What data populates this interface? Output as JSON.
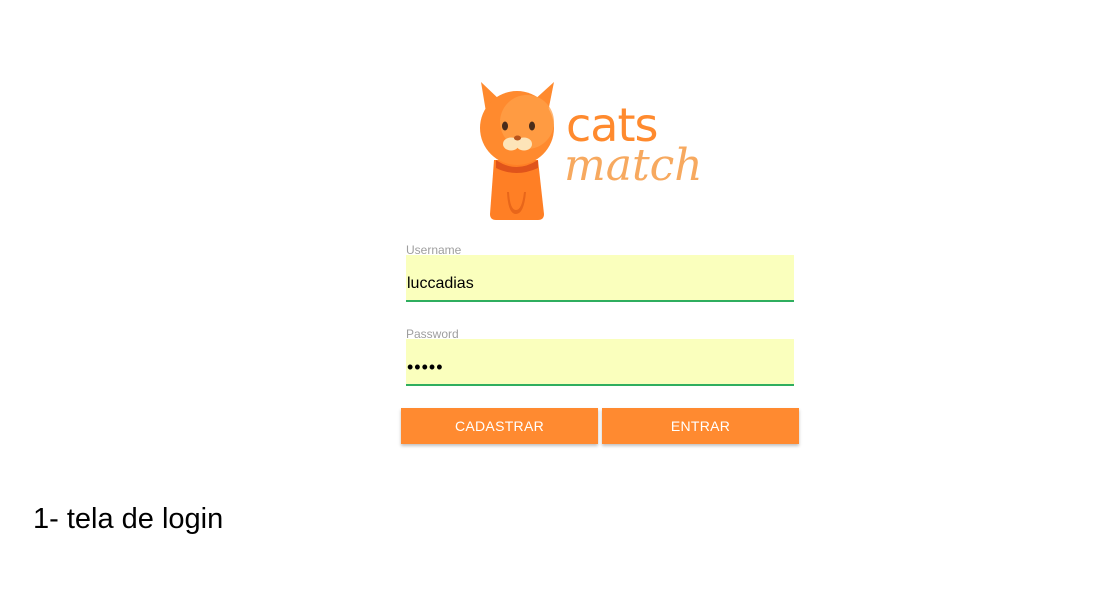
{
  "logo": {
    "word_top": "cats",
    "word_bottom": "match",
    "icon": "cat-mascot-icon",
    "colors": {
      "primary": "#ff8a2e",
      "secondary": "#f7a95f"
    }
  },
  "form": {
    "username": {
      "label": "Username",
      "value": "luccadias"
    },
    "password": {
      "label": "Password",
      "value": "•••••"
    },
    "autofill_bg": "#faffbd",
    "focus_underline": "#2fae5f"
  },
  "buttons": {
    "register_label": "CADASTRAR",
    "login_label": "ENTRAR",
    "color": "#ff8a30"
  },
  "caption": "1- tela de login"
}
